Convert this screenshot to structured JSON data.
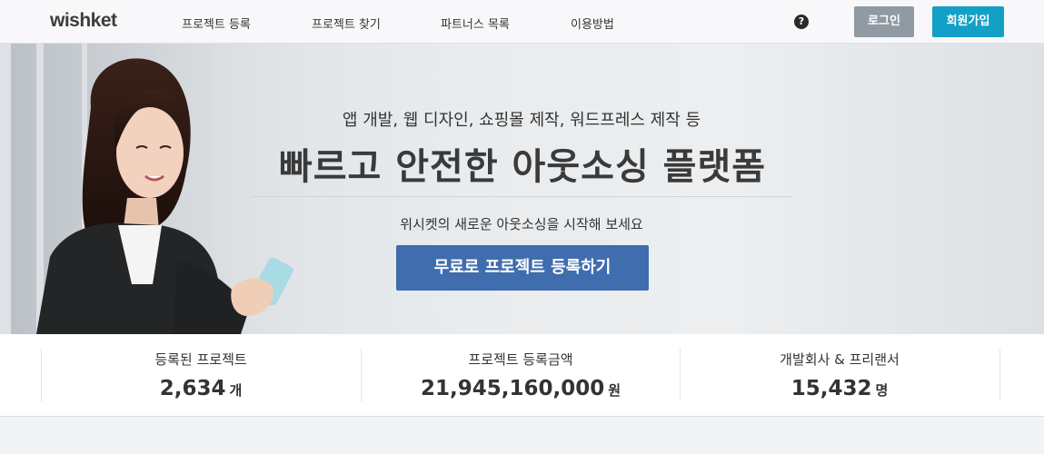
{
  "header": {
    "logo": "wishket",
    "nav": [
      "프로젝트 등록",
      "프로젝트 찾기",
      "파트너스 목록",
      "이용방법"
    ],
    "help_icon": "?",
    "login_label": "로그인",
    "signup_label": "회원가입"
  },
  "hero": {
    "subtitle": "앱 개발, 웹 디자인, 쇼핑몰 제작, 워드프레스 제작 등",
    "title": "빠르고 안전한 아웃소싱 플랫폼",
    "description": "위시켓의 새로운 아웃소싱을 시작해 보세요",
    "cta_label": "무료로 프로젝트 등록하기"
  },
  "stats": [
    {
      "label": "등록된 프로젝트",
      "value": "2,634",
      "unit": "개"
    },
    {
      "label": "프로젝트 등록금액",
      "value": "21,945,160,000",
      "unit": "원"
    },
    {
      "label": "개발회사 & 프리랜서",
      "value": "15,432",
      "unit": "명"
    }
  ],
  "colors": {
    "signup": "#12a0c7",
    "login": "#8f9aa3",
    "cta": "#3f6dad"
  }
}
